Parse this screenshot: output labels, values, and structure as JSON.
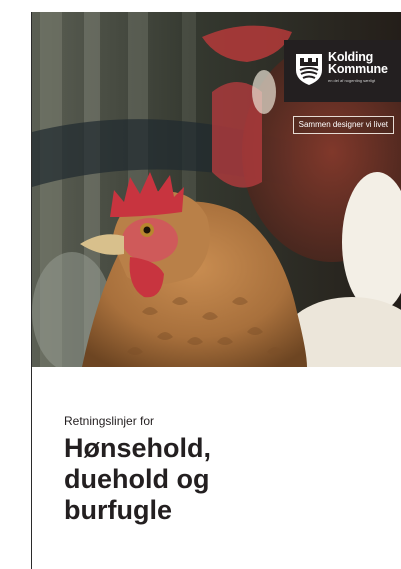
{
  "logo": {
    "name_line1": "Kolding",
    "name_line2": "Kommune",
    "tagline": "en del af nogenting særligt"
  },
  "slogan": "Sammen designer vi livet",
  "cover": {
    "lead": "Retningslinjer for",
    "title_line1": "Hønsehold,",
    "title_line2": "duehold og",
    "title_line3": "burfugle"
  },
  "colors": {
    "logo_background": "#231f20",
    "text": "#231f20",
    "comb_red": "#c8343f",
    "feather_brown": "#a8703c"
  }
}
